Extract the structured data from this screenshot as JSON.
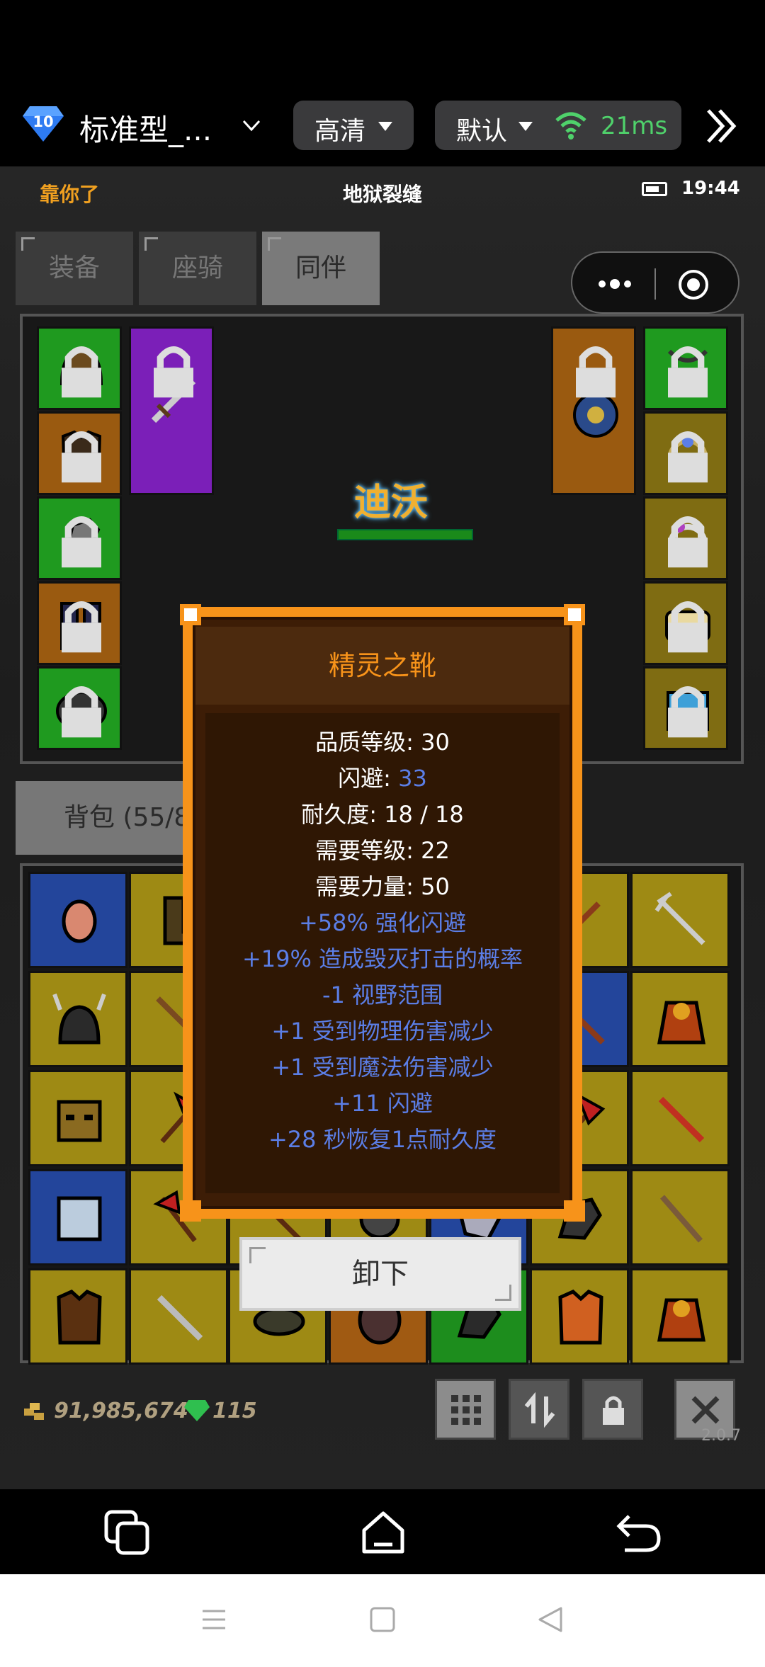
{
  "topbar": {
    "badge_number": "10",
    "title": "标准型_...",
    "quality": "高清",
    "network_mode": "默认",
    "ping": "21ms"
  },
  "game_header": {
    "left_text": "靠你了",
    "location": "地狱裂缝",
    "time": "19:44"
  },
  "tabs": [
    {
      "label": "装备",
      "active": false
    },
    {
      "label": "座骑",
      "active": false
    },
    {
      "label": "同伴",
      "active": true
    }
  ],
  "companion": {
    "name": "迪沃"
  },
  "bag": {
    "label": "背包 (55/8"
  },
  "tooltip": {
    "item_name": "精灵之靴",
    "quality_level_label": "品质等级: 30",
    "dodge_label": "闪避: ",
    "dodge_value": "33",
    "durability": "耐久度: 18 / 18",
    "req_level": "需要等级: 22",
    "req_strength": "需要力量: 50",
    "affixes": [
      "+58% 强化闪避",
      "+19% 造成毁灭打击的概率",
      "-1 视野范围",
      "+1 受到物理伤害减少",
      "+1 受到魔法伤害减少",
      "+11 闪避",
      "+28 秒恢复1点耐久度"
    ]
  },
  "unequip_button": "卸下",
  "currency": {
    "gold": "91,985,674",
    "gems": "115"
  },
  "version": "2.0.7",
  "colors": {
    "accent_orange": "#f7931a",
    "affix_blue": "#5b7ee6",
    "ping_green": "#4fd16b"
  },
  "icons": [
    "diamond-badge-icon",
    "chevron-down-icon",
    "wifi-icon",
    "fast-forward-icon",
    "more-dots-icon",
    "target-icon",
    "grid-icon",
    "sort-icon",
    "lock-icon",
    "close-icon",
    "recent-apps-icon",
    "home-icon",
    "back-icon"
  ]
}
